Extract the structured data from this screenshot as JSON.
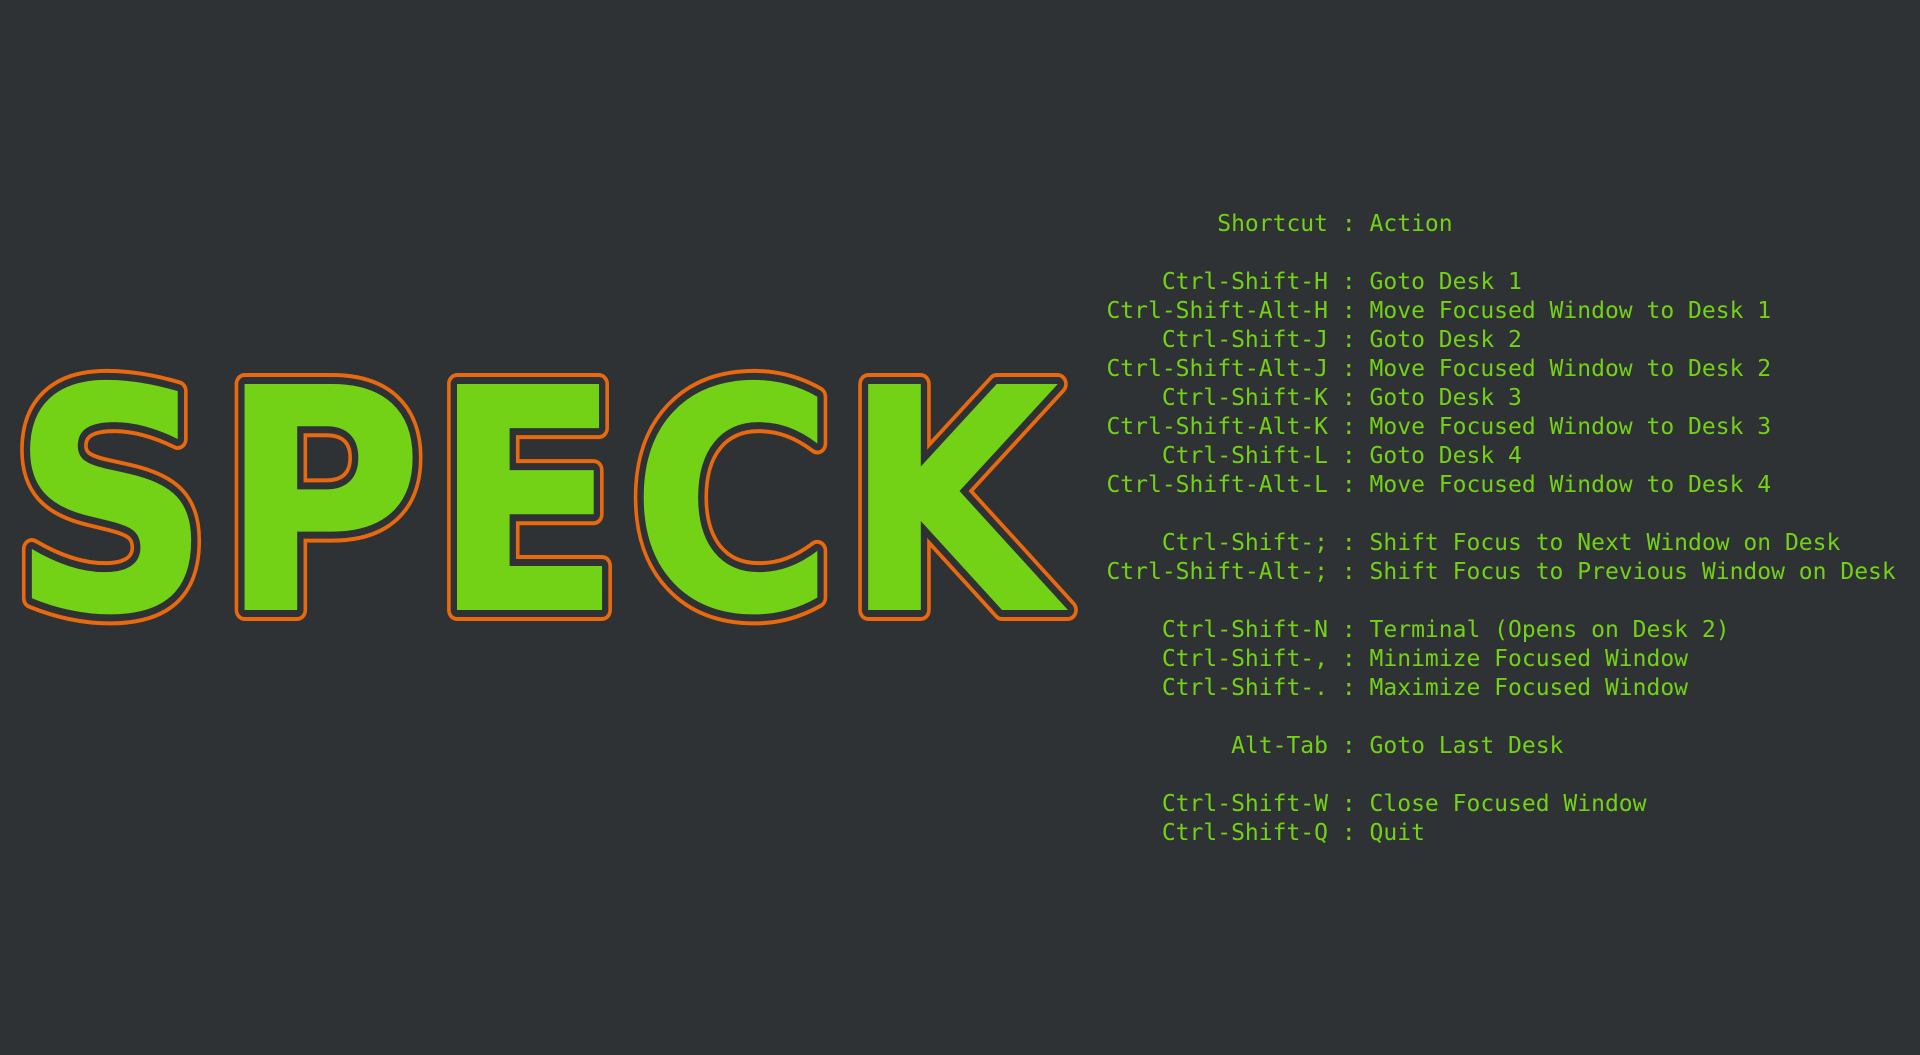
{
  "logo": {
    "text": "SPECK",
    "fill": "#73d216",
    "outline": "#e9690f",
    "inner_stroke": "#2e3235"
  },
  "background": "#2e3235",
  "text_color": "#73d216",
  "separator": " : ",
  "header": {
    "key": "Shortcut",
    "action": "Action"
  },
  "groups": [
    {
      "rows": [
        {
          "key": "Ctrl-Shift-H",
          "action": "Goto Desk 1"
        },
        {
          "key": "Ctrl-Shift-Alt-H",
          "action": "Move Focused Window to Desk 1"
        },
        {
          "key": "Ctrl-Shift-J",
          "action": "Goto Desk 2"
        },
        {
          "key": "Ctrl-Shift-Alt-J",
          "action": "Move Focused Window to Desk 2"
        },
        {
          "key": "Ctrl-Shift-K",
          "action": "Goto Desk 3"
        },
        {
          "key": "Ctrl-Shift-Alt-K",
          "action": "Move Focused Window to Desk 3"
        },
        {
          "key": "Ctrl-Shift-L",
          "action": "Goto Desk 4"
        },
        {
          "key": "Ctrl-Shift-Alt-L",
          "action": "Move Focused Window to Desk 4"
        }
      ]
    },
    {
      "rows": [
        {
          "key": "Ctrl-Shift-;",
          "action": "Shift Focus to Next Window on Desk"
        },
        {
          "key": "Ctrl-Shift-Alt-;",
          "action": "Shift Focus to Previous Window on Desk"
        }
      ]
    },
    {
      "rows": [
        {
          "key": "Ctrl-Shift-N",
          "action": "Terminal (Opens on Desk 2)"
        },
        {
          "key": "Ctrl-Shift-,",
          "action": "Minimize Focused Window"
        },
        {
          "key": "Ctrl-Shift-.",
          "action": "Maximize Focused Window"
        }
      ]
    },
    {
      "rows": [
        {
          "key": "Alt-Tab",
          "action": "Goto Last Desk"
        }
      ]
    },
    {
      "rows": [
        {
          "key": "Ctrl-Shift-W",
          "action": "Close Focused Window"
        },
        {
          "key": "Ctrl-Shift-Q",
          "action": "Quit"
        }
      ]
    }
  ]
}
